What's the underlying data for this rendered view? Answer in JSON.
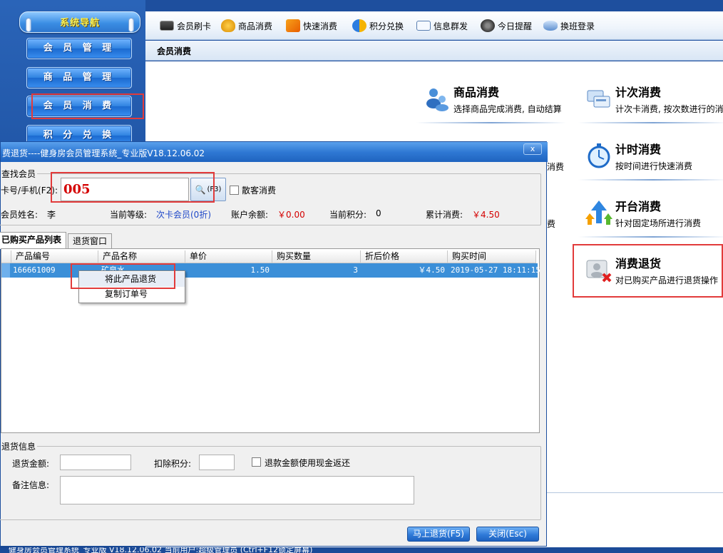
{
  "nav": {
    "header": "系统导航",
    "items": [
      "会 员 管 理",
      "商 品 管 理",
      "会 员 消 费",
      "积 分 兑 换"
    ]
  },
  "toolbar": {
    "items": [
      {
        "label": "会员刷卡",
        "icon": "card-reader-icon"
      },
      {
        "label": "商品消费",
        "icon": "money-bag-icon"
      },
      {
        "label": "快速消费",
        "icon": "fast-consume-icon"
      },
      {
        "label": "积分兑换",
        "icon": "exchange-icon"
      },
      {
        "label": "信息群发",
        "icon": "envelope-icon"
      },
      {
        "label": "今日提醒",
        "icon": "clock-icon"
      },
      {
        "label": "换班登录",
        "icon": "shift-login-icon"
      }
    ]
  },
  "panel": {
    "title": "会员消费",
    "features": [
      {
        "title": "商品消费",
        "desc": "选择商品完成消费, 自动结算"
      },
      {
        "title": "计次消费",
        "desc": "计次卡消费, 按次数进行的消"
      },
      {
        "title": "计时消费",
        "desc": "按时间进行快速消费"
      },
      {
        "title": "开台消费",
        "desc": "针对固定场所进行消费"
      },
      {
        "title": "消费退货",
        "desc": "对已购买产品进行退货操作"
      }
    ],
    "hidden_desc_fragments": [
      "消费",
      "费"
    ]
  },
  "dialog": {
    "title": "费退货----健身房会员管理系统_专业版V18.12.06.02",
    "close_label": "x",
    "find_group": "查找会员",
    "card_label": "卡号/手机(F2):",
    "card_value": "005",
    "search_label": "(F3)",
    "walkin_label": "散客消费",
    "info": {
      "name_label": "会员姓名:",
      "name_value": "李",
      "level_label": "当前等级:",
      "level_value": "次卡会员(0折)",
      "balance_label": "账户余额:",
      "balance_value": "￥0.00",
      "points_label": "当前积分:",
      "points_value": "0",
      "total_label": "累计消费:",
      "total_value": "￥4.50"
    },
    "tabs": [
      "已购买产品列表",
      "退货窗口"
    ],
    "columns": [
      "产品编号",
      "产品名称",
      "单价",
      "购买数量",
      "折后价格",
      "购买时间"
    ],
    "rows": [
      {
        "code": "166661009",
        "name": "矿泉水",
        "price": "1.50",
        "qty": "3",
        "discounted": "￥4.50",
        "time": "2019-05-27 18:11:15"
      }
    ],
    "context_menu": [
      "将此产品退货",
      "复制订单号"
    ],
    "return_group": "退货信息",
    "return_amount_label": "退货金额:",
    "deduct_points_label": "扣除积分:",
    "cash_back_label": "退款金额使用现金返还",
    "remark_label": "备注信息:",
    "btn_return": "马上退货(F5)",
    "btn_close": "关闭(Esc)"
  },
  "statusbar": "健身房会员管理系统_专业版 V18.12.06.02 当前用户:超级管理员 (Ctrl+F12锁定屏幕)",
  "colors": {
    "accent": "#2f79d4",
    "highlight_box": "#e23b3b",
    "money": "#d40000",
    "selected_row": "#3b8fd8"
  }
}
